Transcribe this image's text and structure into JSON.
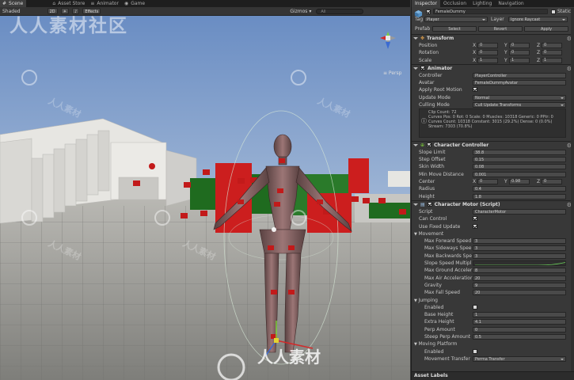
{
  "scene_tabs": [
    {
      "label": "Scene",
      "icon": "#"
    },
    {
      "label": "Asset Store",
      "icon": "⌂"
    },
    {
      "label": "Animator",
      "icon": "≡"
    },
    {
      "label": "Game",
      "icon": "◉"
    }
  ],
  "toolbar": {
    "shading": "Shaded",
    "mode_2d": "2D",
    "sun": "☀",
    "audio": "♪",
    "fx": "Effects",
    "gizmos": "Gizmos ▾",
    "search_placeholder": "All"
  },
  "viewport": {
    "persp_label": "≡ Persp",
    "watermark": "人人素材社区",
    "watermark_logo": "人人素材",
    "sky_top": "#6d8fc4",
    "sky_bottom": "#c9d4e2",
    "ground": "#8a8a86",
    "accent": "#cc2020"
  },
  "inspector": {
    "tabs": [
      "Inspector",
      "Occlusion",
      "Lighting",
      "Navigation"
    ],
    "object_name": "FemaleDummy",
    "static_label": "Static",
    "tag_label": "Tag",
    "tag_value": "Player",
    "layer_label": "Layer",
    "layer_value": "Ignore Raycast",
    "prefab_label": "Prefab",
    "prefab_buttons": [
      "Select",
      "Revert",
      "Apply"
    ],
    "transform": {
      "title": "Transform",
      "rows": [
        {
          "label": "Position",
          "x": "0",
          "y": "0",
          "z": "0"
        },
        {
          "label": "Rotation",
          "x": "0",
          "y": "0",
          "z": "0"
        },
        {
          "label": "Scale",
          "x": "1",
          "y": "1",
          "z": "1"
        }
      ]
    },
    "animator": {
      "title": "Animator",
      "rows": [
        {
          "label": "Controller",
          "value": "PlayerController",
          "type": "obj"
        },
        {
          "label": "Avatar",
          "value": "FemaleDummyAvatar",
          "type": "obj"
        },
        {
          "label": "Apply Root Motion",
          "value": "",
          "type": "check"
        },
        {
          "label": "Update Mode",
          "value": "Normal",
          "type": "dd"
        },
        {
          "label": "Culling Mode",
          "value": "Cull Update Transforms",
          "type": "dd"
        }
      ],
      "info": [
        "Clip Count: 72",
        "Curves Pos: 0 Rot: 0 Scale: 0 Muscles: 10318 Generic: 0 PPtr: 0",
        "Curves Count: 10318 Constant: 3015 (29.2%) Dense: 0 (0.0%) Stream: 7303 (70.8%)"
      ]
    },
    "character_controller": {
      "title": "Character Controller",
      "rows": [
        {
          "label": "Slope Limit",
          "value": "38.8"
        },
        {
          "label": "Step Offset",
          "value": "0.15"
        },
        {
          "label": "Skin Width",
          "value": "0.08"
        },
        {
          "label": "Min Move Distance",
          "value": "0.001"
        }
      ],
      "center": {
        "label": "Center",
        "x": "0",
        "y": "0.98",
        "z": "0"
      },
      "rows2": [
        {
          "label": "Radius",
          "value": "0.4"
        },
        {
          "label": "Height",
          "value": "1.8"
        }
      ]
    },
    "character_motor": {
      "title": "Character Motor (Script)",
      "rows": [
        {
          "label": "Script",
          "value": "CharacterMotor",
          "type": "obj",
          "indent": 0
        },
        {
          "label": "Can Control",
          "value": "",
          "type": "check",
          "indent": 0
        },
        {
          "label": "Use Fixed Update",
          "value": "",
          "type": "check",
          "indent": 0
        },
        {
          "label": "Movement",
          "value": "",
          "type": "sec",
          "indent": 0
        },
        {
          "label": "Max Forward Speed",
          "value": "3",
          "type": "num",
          "indent": 1
        },
        {
          "label": "Max Sideways Spee",
          "value": "3",
          "type": "num",
          "indent": 1
        },
        {
          "label": "Max Backwards Spe",
          "value": "3",
          "type": "num",
          "indent": 1
        },
        {
          "label": "Slope Speed Multipl",
          "value": "",
          "type": "curve",
          "indent": 1
        },
        {
          "label": "Max Ground Acceler",
          "value": "8",
          "type": "num",
          "indent": 1
        },
        {
          "label": "Max Air Acceleratior",
          "value": "20",
          "type": "num",
          "indent": 1
        },
        {
          "label": "Gravity",
          "value": "9",
          "type": "num",
          "indent": 1
        },
        {
          "label": "Max Fall Speed",
          "value": "20",
          "type": "num",
          "indent": 1
        },
        {
          "label": "Jumping",
          "value": "",
          "type": "sec",
          "indent": 0
        },
        {
          "label": "Enabled",
          "value": "",
          "type": "uncheck",
          "indent": 1
        },
        {
          "label": "Base Height",
          "value": "1",
          "type": "num",
          "indent": 1
        },
        {
          "label": "Extra Height",
          "value": "4.1",
          "type": "num",
          "indent": 1
        },
        {
          "label": "Perp Amount",
          "value": "0",
          "type": "num",
          "indent": 1
        },
        {
          "label": "Steep Perp Amount",
          "value": "0.5",
          "type": "num",
          "indent": 1
        },
        {
          "label": "Moving Platform",
          "value": "",
          "type": "sec",
          "indent": 0
        },
        {
          "label": "Enabled",
          "value": "",
          "type": "uncheck",
          "indent": 1
        },
        {
          "label": "Movement Transfer",
          "value": "Perma Transfer",
          "type": "dd",
          "indent": 1
        }
      ]
    },
    "footer": "Asset Labels"
  }
}
